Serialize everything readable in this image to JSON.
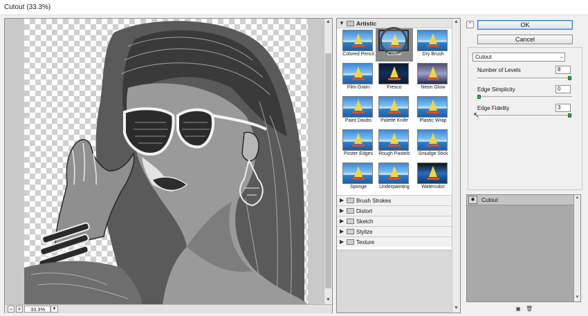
{
  "window": {
    "title": "Cutout (33.3%)"
  },
  "preview": {
    "zoom_out_icon": "−",
    "zoom_in_icon": "+",
    "zoom_value": "33.3%"
  },
  "gallery": {
    "open_category": "Artistic",
    "filters": [
      {
        "label": "Colored Pencil"
      },
      {
        "label": "Cutout",
        "selected": true
      },
      {
        "label": "Dry Brush"
      },
      {
        "label": "Film Grain"
      },
      {
        "label": "Fresco"
      },
      {
        "label": "Neon Glow"
      },
      {
        "label": "Paint Daubs"
      },
      {
        "label": "Palette Knife"
      },
      {
        "label": "Plastic Wrap"
      },
      {
        "label": "Poster Edges"
      },
      {
        "label": "Rough Pastels"
      },
      {
        "label": "Smudge Stick"
      },
      {
        "label": "Sponge"
      },
      {
        "label": "Underpainting"
      },
      {
        "label": "Watercolor"
      }
    ],
    "categories": [
      {
        "label": "Brush Strokes"
      },
      {
        "label": "Distort"
      },
      {
        "label": "Sketch"
      },
      {
        "label": "Stylize"
      },
      {
        "label": "Texture"
      }
    ]
  },
  "buttons": {
    "ok": "OK",
    "cancel": "Cancel"
  },
  "settings": {
    "filter_select": "Cutout",
    "params": [
      {
        "label": "Number of Levels",
        "value": "8",
        "fraction": 1.0
      },
      {
        "label": "Edge Simplicity",
        "value": "0",
        "fraction": 0.0
      },
      {
        "label": "Edge Fidelity",
        "value": "3",
        "fraction": 1.0
      }
    ]
  },
  "layers": {
    "items": [
      {
        "label": "Cutout"
      }
    ]
  },
  "colors": {
    "accent": "#3c7fd0",
    "slider_knob": "#3aa14a",
    "selected_thumb": "#8a8a8a"
  }
}
